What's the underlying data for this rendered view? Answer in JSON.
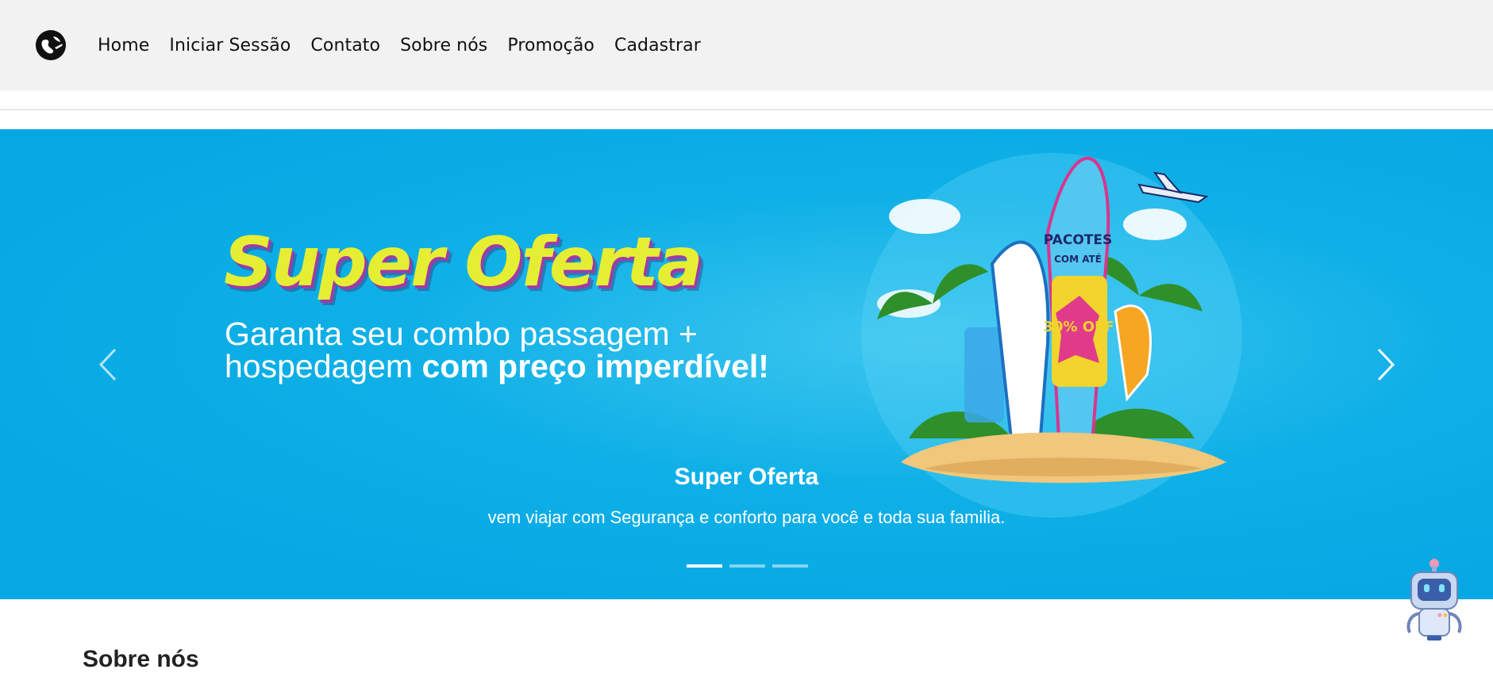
{
  "nav": {
    "logo_icon": "globe-plane-logo-icon",
    "items": [
      {
        "label": "Home"
      },
      {
        "label": "Iniciar Sessão"
      },
      {
        "label": "Contato"
      },
      {
        "label": "Sobre nós"
      },
      {
        "label": "Promoção"
      },
      {
        "label": "Cadastrar"
      }
    ]
  },
  "carousel": {
    "banner": {
      "title": "Super Oferta",
      "subtitle_line1": "Garanta seu combo passagem +",
      "subtitle_line2_plain": "hospedagem ",
      "subtitle_line2_bold": "com preço imperdível!",
      "board_text_1": "PACOTES",
      "board_text_2": "COM ATÉ",
      "discount": "30% OFF"
    },
    "caption_title": "Super Oferta",
    "caption_text": "vem viajar com Segurança e conforto para você e toda sua familia.",
    "prev_icon": "chevron-left-icon",
    "next_icon": "chevron-right-icon",
    "indicators": [
      {
        "active": true
      },
      {
        "active": false
      },
      {
        "active": false
      }
    ],
    "colors": {
      "background": "#06a8e4",
      "title": "#e6ee34",
      "title_shadow": "#a23aa6"
    }
  },
  "section": {
    "heading": "Sobre nós"
  },
  "chatbot": {
    "icon": "robot-chatbot-icon"
  }
}
